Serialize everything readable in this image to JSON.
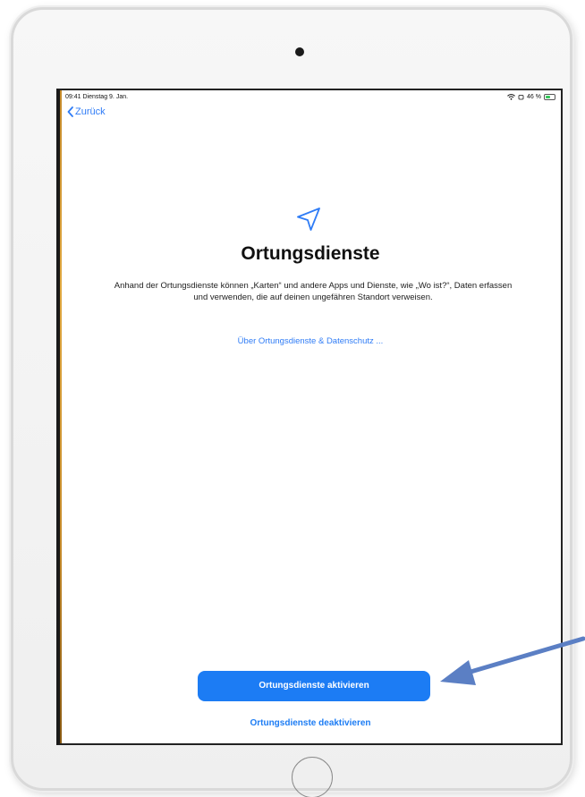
{
  "status_bar": {
    "time_date": "09:41  Dienstag 9. Jan.",
    "battery": "46 %",
    "battery_level": 0.46
  },
  "nav": {
    "back_label": "Zurück"
  },
  "page": {
    "icon": "location-arrow-icon",
    "title": "Ortungsdienste",
    "description": "Anhand der Ortungsdienste können „Karten“ und andere Apps und Dienste, wie „Wo ist?“, Daten erfassen und verwenden, die auf deinen ungefähren Standort verweisen.",
    "privacy_link": "Über Ortungsdienste & Datenschutz ..."
  },
  "actions": {
    "activate_label": "Ortungsdienste aktivieren",
    "deactivate_label": "Ortungsdienste deaktivieren"
  },
  "colors": {
    "accent": "#1c7cf4",
    "annotation_arrow": "#5b7fc4"
  }
}
